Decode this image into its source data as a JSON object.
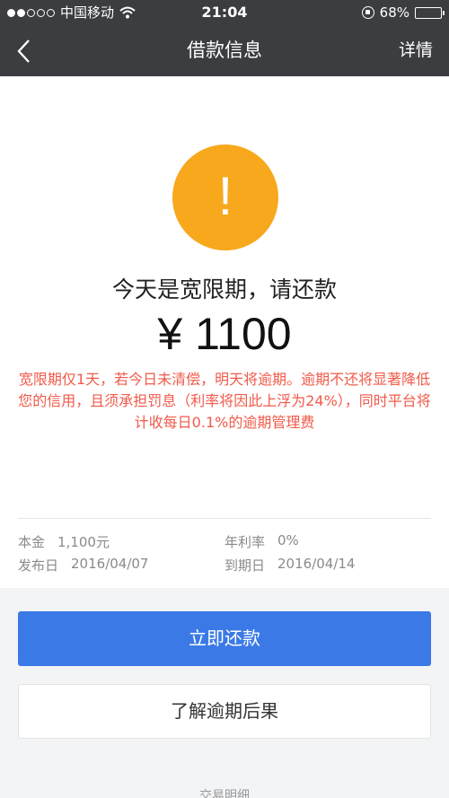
{
  "status_bar": {
    "carrier": "中国移动",
    "time": "21:04",
    "battery": "68%",
    "battery_level": 0.68
  },
  "nav": {
    "title": "借款信息",
    "detail_label": "详情"
  },
  "alert": {
    "icon_glyph": "!",
    "icon_color": "#f7a81d",
    "headline": "今天是宽限期，请还款",
    "amount": "¥ 1100",
    "notice": "宽限期仅1天，若今日未清偿，明天将逾期。逾期不还将显著降低您的信用，且须承担罚息（利率将因此上浮为24%），同时平台将计收每日0.1%的逾期管理费",
    "notice_color": "#f05a4a"
  },
  "info": {
    "principal_label": "本金",
    "principal_value": "1,100元",
    "rate_label": "年利率",
    "rate_value": "0%",
    "issue_label": "发布日",
    "issue_value": "2016/04/07",
    "due_label": "到期日",
    "due_value": "2016/04/14"
  },
  "actions": {
    "pay_label": "立即还款",
    "pay_color": "#3b7ae6",
    "learn_label": "了解逾期后果"
  },
  "footer": {
    "link_label": "交易明细"
  }
}
